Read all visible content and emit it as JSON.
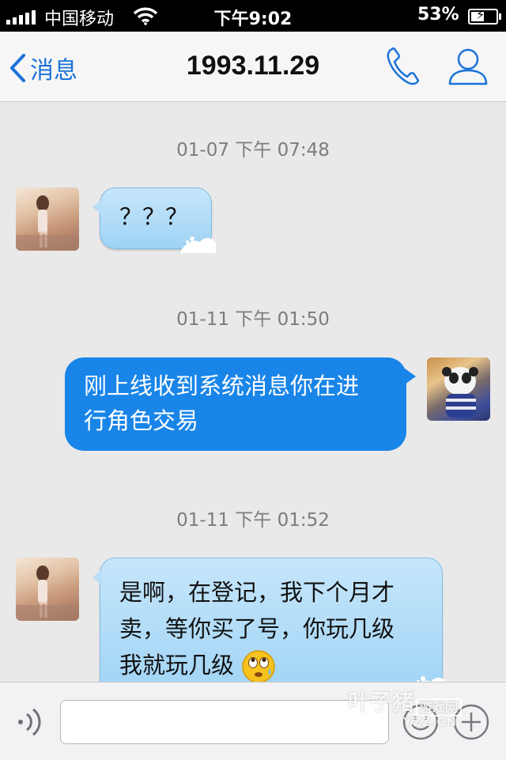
{
  "status_bar": {
    "carrier": "中国移动",
    "time": "下午9:02",
    "battery": "53%",
    "battery_level": 0.53
  },
  "nav": {
    "back_label": "消息",
    "title": "1993.11.29",
    "icons": [
      "chevron-left-icon",
      "phone-icon",
      "contact-icon"
    ]
  },
  "messages": [
    {
      "timestamp": "01-07 下午 07:48",
      "direction": "incoming",
      "text": "？？？"
    },
    {
      "timestamp": "01-11 下午 01:50",
      "direction": "outgoing",
      "text_line1": "刚上线收到系统消息你在进",
      "text_line2": "行角色交易"
    },
    {
      "timestamp": "01-11 下午 01:52",
      "direction": "incoming",
      "text_line1": "是啊，在登记，我下个月才",
      "text_line2": "卖，等你买了号，你玩几级",
      "text_line3": "我就玩几级",
      "emoji": "rolling-eyes-emoji"
    }
  ],
  "input_bar": {
    "placeholder": "",
    "icons": [
      "voice-icon",
      "emoji-icon",
      "plus-icon"
    ]
  },
  "watermark": {
    "brand": "叶子猪",
    "box_text": "游戏网",
    "url": "YZZ.CN"
  },
  "colors": {
    "accent": "#1a73d9",
    "outgoing_bubble": "#1985e8",
    "incoming_bubble": "#b8def8"
  }
}
